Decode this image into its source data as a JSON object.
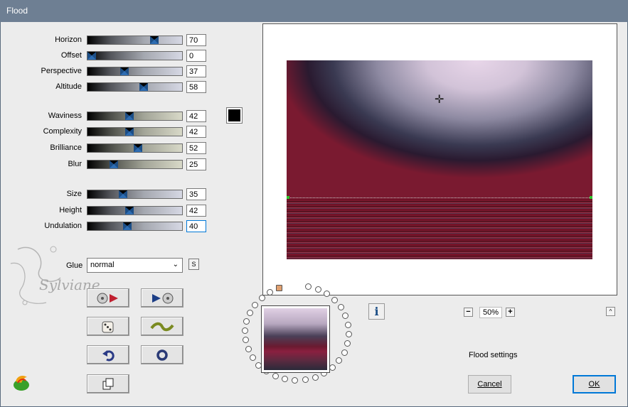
{
  "window": {
    "title": "Flood"
  },
  "sliders_group1": [
    {
      "label": "Horizon",
      "value": "70",
      "track": "gray",
      "pos": 0.7
    },
    {
      "label": "Offset",
      "value": "0",
      "track": "gray",
      "pos": 0.0
    },
    {
      "label": "Perspective",
      "value": "37",
      "track": "gray",
      "pos": 0.37
    },
    {
      "label": "Altitude",
      "value": "58",
      "track": "gray",
      "pos": 0.58
    }
  ],
  "sliders_group2": [
    {
      "label": "Waviness",
      "value": "42",
      "track": "beige",
      "pos": 0.42
    },
    {
      "label": "Complexity",
      "value": "42",
      "track": "beige",
      "pos": 0.42
    },
    {
      "label": "Brilliance",
      "value": "52",
      "track": "beige",
      "pos": 0.52
    },
    {
      "label": "Blur",
      "value": "25",
      "track": "beige",
      "pos": 0.25
    }
  ],
  "sliders_group3": [
    {
      "label": "Size",
      "value": "35",
      "track": "gray",
      "pos": 0.35
    },
    {
      "label": "Height",
      "value": "42",
      "track": "gray",
      "pos": 0.42
    },
    {
      "label": "Undulation",
      "value": "40",
      "track": "gray",
      "pos": 0.4
    }
  ],
  "color_swatch": "#000000",
  "glue": {
    "label": "Glue",
    "value": "normal",
    "s_button": "S"
  },
  "preview": {
    "zoom": "50%",
    "status": "Flood settings"
  },
  "buttons": {
    "cancel": "Cancel",
    "ok": "OK"
  },
  "watermark_text": "Sylviane",
  "icons": {
    "info": "i",
    "zoom_out": "−",
    "zoom_in": "+",
    "collapse": "^"
  }
}
